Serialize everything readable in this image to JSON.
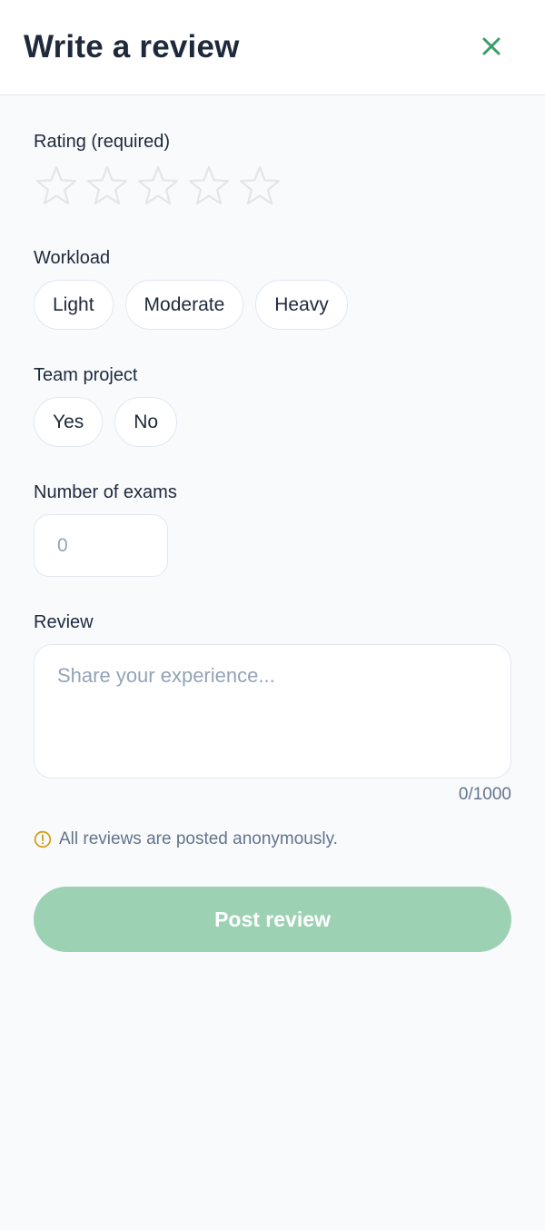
{
  "header": {
    "title": "Write a review",
    "close_icon": "close-icon"
  },
  "rating": {
    "label": "Rating (required)",
    "max_stars": 5,
    "selected": 0,
    "star_icon": "star-outline-icon"
  },
  "workload": {
    "label": "Workload",
    "options": [
      "Light",
      "Moderate",
      "Heavy"
    ]
  },
  "team_project": {
    "label": "Team project",
    "options": [
      "Yes",
      "No"
    ]
  },
  "exams": {
    "label": "Number of exams",
    "value": "",
    "placeholder": "0"
  },
  "review": {
    "label": "Review",
    "value": "",
    "placeholder": "Share your experience...",
    "char_count": "0/1000"
  },
  "notice": {
    "icon": "info-circle-icon",
    "text": "All reviews are posted anonymously."
  },
  "submit": {
    "label": "Post review",
    "enabled": false
  },
  "colors": {
    "accent": "#3a9d6a",
    "button_disabled": "#9dd1b4",
    "warning": "#d4a017",
    "text": "#1e293b",
    "muted": "#64748b",
    "placeholder": "#94a3b8",
    "border": "#e2e8f0",
    "star_outline": "#e2e6ea"
  }
}
